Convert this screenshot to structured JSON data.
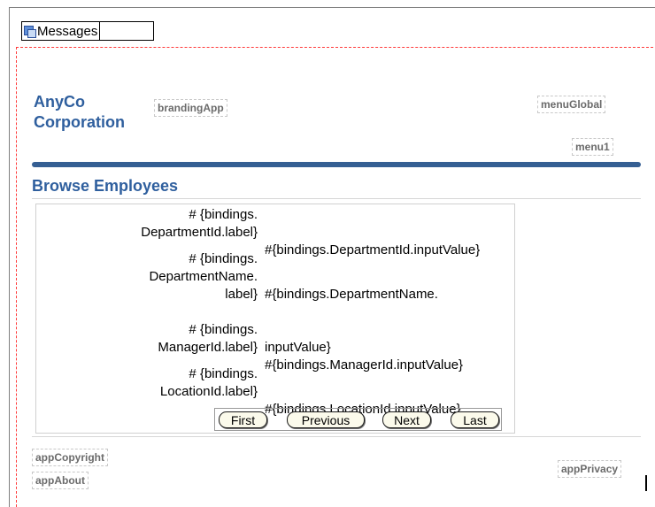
{
  "messages": {
    "label": "Messages"
  },
  "header": {
    "brand_line1": "AnyCo",
    "brand_line2": "Corporation",
    "branding_app": "brandingApp",
    "menu_global": "menuGlobal",
    "menu1": "menu1"
  },
  "page": {
    "title": "Browse Employees"
  },
  "form": {
    "rows": [
      {
        "label_lines": [
          "# {bindings.",
          "DepartmentId.label}"
        ],
        "value_lines": [
          "#{bindings.DepartmentId.inputValue}"
        ]
      },
      {
        "label_lines": [
          "# {bindings.",
          "DepartmentName.",
          "label}"
        ],
        "value_lines": [
          "#{bindings.DepartmentName.",
          "inputValue}"
        ]
      },
      {
        "label_lines": [
          "# {bindings.",
          "ManagerId.label}"
        ],
        "value_lines": [
          "#{bindings.ManagerId.inputValue}"
        ]
      },
      {
        "label_lines": [
          "# {bindings.",
          "LocationId.label}"
        ],
        "value_lines": [
          "#{bindings.LocationId.inputValue}"
        ]
      }
    ]
  },
  "nav": {
    "first": "First",
    "previous": "Previous",
    "next": "Next",
    "last": "Last"
  },
  "footer": {
    "copyright": "appCopyright",
    "about": "appAbout",
    "privacy": "appPrivacy"
  },
  "colors": {
    "brand": "#2f5f9e",
    "rule": "#355f93",
    "button_fill": "#fbfaeb",
    "dashed_border": "#ff3a3a"
  }
}
